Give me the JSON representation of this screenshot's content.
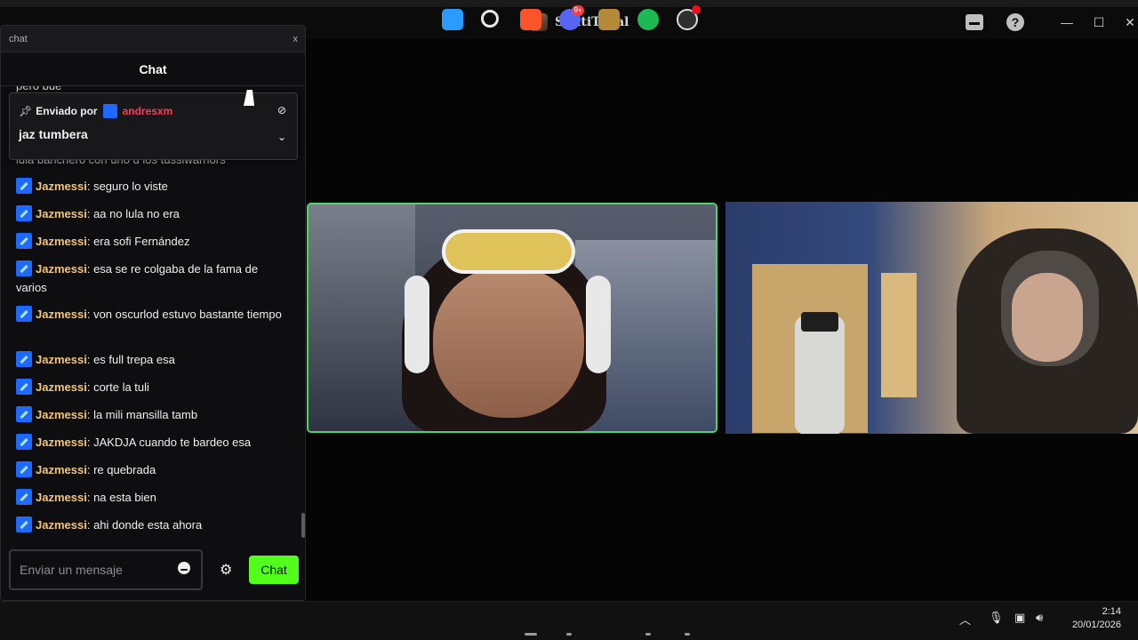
{
  "window": {
    "title": "SantiTobal",
    "minimize_glyph": "—",
    "maximize_glyph": "☐",
    "close_glyph": "✕"
  },
  "chat": {
    "popout_title": "chat",
    "popout_close": "x",
    "header": "Chat",
    "partial_top": "pero bue",
    "partial_under_pin": "lula banchero con uno d los tussiwarriors",
    "pinned": {
      "label": "Enviado por",
      "user": "andresxm",
      "text": "jaz tumbera",
      "user_color": "#ff3d57"
    },
    "messages": [
      {
        "user": "Jazmessi",
        "text": "seguro lo viste"
      },
      {
        "user": "Jazmessi",
        "text": "aa no lula no era"
      },
      {
        "user": "Jazmessi",
        "text": "era sofi Fernández"
      },
      {
        "user": "Jazmessi",
        "text": "esa se re colgaba de la fama de varios"
      },
      {
        "user": "Jazmessi",
        "text": "von oscurlod estuvo bastante tiempo"
      },
      {
        "user": "Jazmessi",
        "text": "es full trepa esa"
      },
      {
        "user": "Jazmessi",
        "text": "corte la tuli"
      },
      {
        "user": "Jazmessi",
        "text": "la mili mansilla tamb"
      },
      {
        "user": "Jazmessi",
        "text": "JAKDJA cuando te bardeo esa"
      },
      {
        "user": "Jazmessi",
        "text": "re quebrada"
      },
      {
        "user": "Jazmessi",
        "text": "na esta bien"
      },
      {
        "user": "Jazmessi",
        "text": "ahi donde esta ahora"
      }
    ],
    "username_color": "#f0c674",
    "composer_placeholder": "Enviar un mensaje",
    "send_label": "Chat",
    "send_color": "#52ff1b"
  },
  "taskbar": {
    "discord_badge": "9+",
    "time": "2:14",
    "date": "20/01/2026"
  },
  "icons": [
    "inbox-icon",
    "help-icon",
    "pin-icon",
    "hide-icon",
    "chevron-down-icon",
    "emoji-icon",
    "gear-icon",
    "mic-icon",
    "network-icon",
    "volume-icon",
    "chevron-up-icon"
  ]
}
